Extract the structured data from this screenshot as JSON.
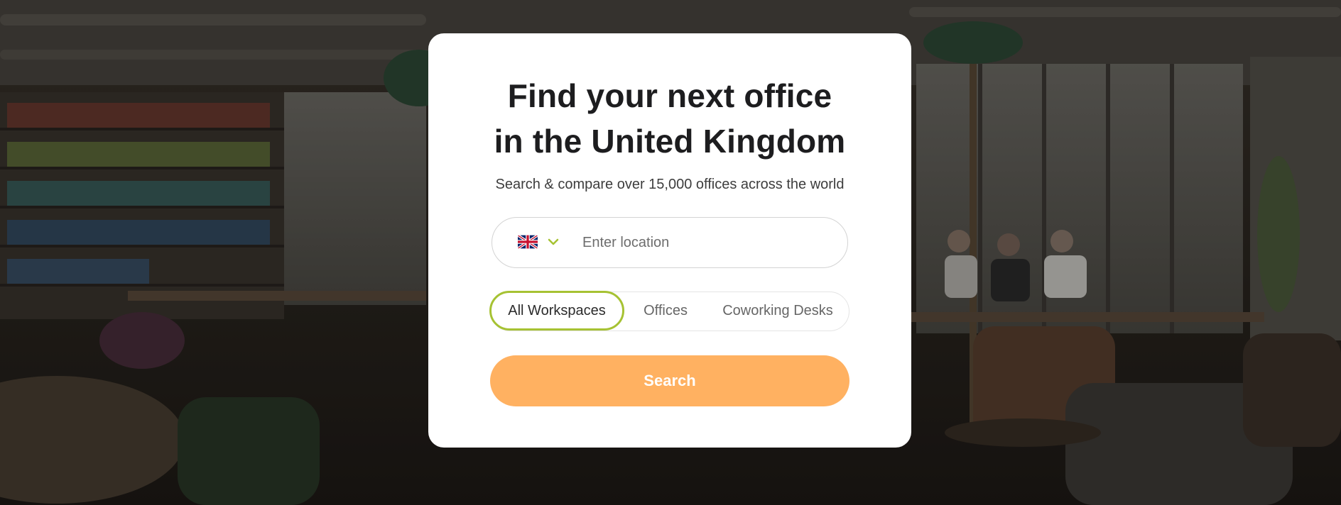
{
  "hero": {
    "title_line1": "Find your next office",
    "title_line2": "in the United Kingdom",
    "subtitle": "Search & compare over 15,000 offices across the world"
  },
  "search": {
    "country_flag": "united-kingdom-flag",
    "country_dropdown_icon": "chevron-down-icon",
    "placeholder": "Enter location",
    "value": ""
  },
  "workspace_types": {
    "items": [
      {
        "label": "All Workspaces",
        "active": true
      },
      {
        "label": "Offices",
        "active": false
      },
      {
        "label": "Coworking Desks",
        "active": false
      }
    ]
  },
  "actions": {
    "search_label": "Search"
  },
  "colors": {
    "accent_green": "#a6c233",
    "search_button": "#ffb161",
    "card_background": "#ffffff",
    "title_text": "#1d1d1f"
  }
}
